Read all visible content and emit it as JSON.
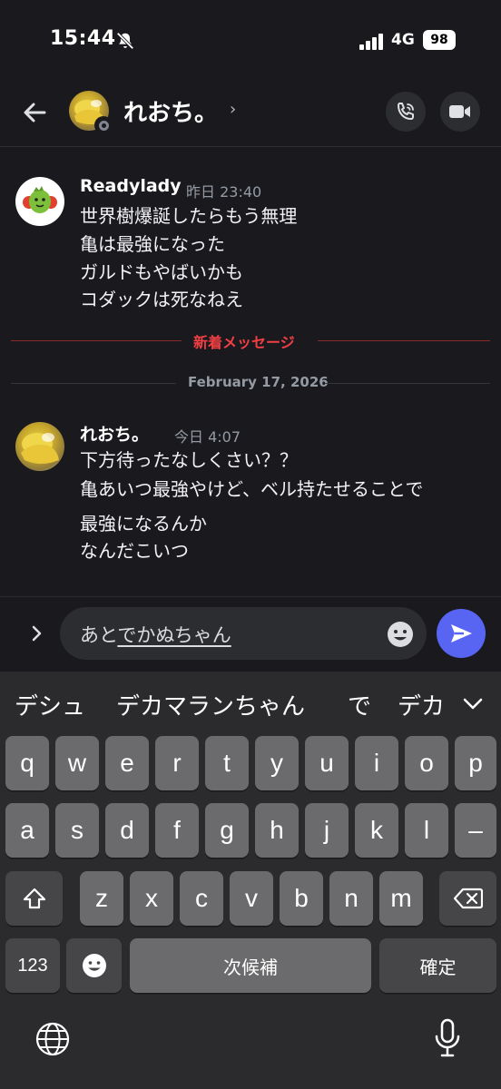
{
  "status_bar": {
    "time": "15:44",
    "network": "4G",
    "battery": "98"
  },
  "header": {
    "title": "れおち。",
    "chevron": "›"
  },
  "messages": [
    {
      "author": "Readylady",
      "time": "昨日 23:40",
      "lines": [
        "世界樹爆誕したらもう無理",
        "亀は最強になった",
        "ガルドもやばいかも",
        "コダックは死なねえ"
      ]
    },
    {
      "author": "れおち。",
      "time": "今日 4:07",
      "lines": [
        "下方待ったなしくさい？？",
        "亀あいつ最強やけど、ベル持たせることで",
        "最強になるんか",
        "なんだこいつ"
      ]
    }
  ],
  "dividers": {
    "new_messages": "新着メッセージ",
    "date": "February 17, 2026"
  },
  "composer": {
    "text_plain": "あと",
    "text_underlined": "でかぬちゃん"
  },
  "keyboard": {
    "suggestions": [
      "デシュ",
      "デカマランちゃん",
      "で",
      "デカ"
    ],
    "row1": [
      "q",
      "w",
      "e",
      "r",
      "t",
      "y",
      "u",
      "i",
      "o",
      "p"
    ],
    "row2": [
      "a",
      "s",
      "d",
      "f",
      "g",
      "h",
      "j",
      "k",
      "l",
      "–"
    ],
    "row3": [
      "z",
      "x",
      "c",
      "v",
      "b",
      "n",
      "m"
    ],
    "numbers_key": "123",
    "space_key": "次候補",
    "confirm_key": "確定"
  },
  "colors": {
    "background": "#1a1a1e",
    "accent": "#5865f2",
    "new_messages": "#f23f43"
  }
}
